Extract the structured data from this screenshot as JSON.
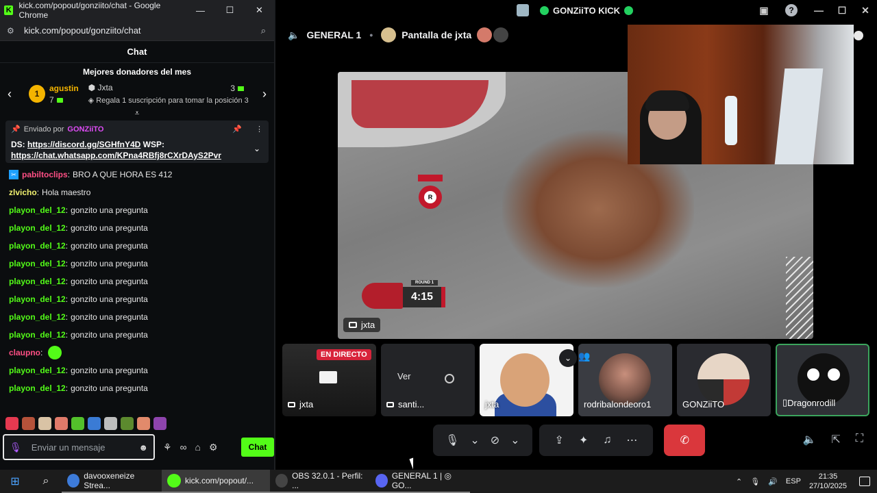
{
  "chrome": {
    "window_title": "kick.com/popout/gonziito/chat - Google Chrome",
    "url": "kick.com/popout/gonziito/chat",
    "win_minimize": "—",
    "win_maximize": "☐",
    "win_close": "✕"
  },
  "chat": {
    "header": "Chat",
    "donors_title": "Mejores donadores del mes",
    "top_donor": {
      "rank": "1",
      "name": "agustin",
      "count": "7"
    },
    "slot": {
      "name": "Jxta",
      "count": "3",
      "gift_text": "Regala 1 suscripción para tomar la posición 3"
    },
    "pinned": {
      "sent_by": "Enviado por",
      "author": "GONZiiTO",
      "line1_prefix": "DS: ",
      "line1_link": "https://discord.gg/SGHfnY4D",
      "line1_suffix": " WSP:",
      "line2_link": "https://chat.whatsapp.com/KPna4RBfj8rCXrDAyS2Pvr"
    },
    "messages": [
      {
        "user": "pabiltoclips",
        "text": "BRO A QUE HORA ES 412",
        "color": "pink",
        "badge": true
      },
      {
        "user": "zlvicho",
        "text": "Hola maestro",
        "color": "yellow",
        "badge": false
      },
      {
        "user": "playon_del_12",
        "text": "gonzito una pregunta",
        "color": "green",
        "badge": false
      },
      {
        "user": "playon_del_12",
        "text": "gonzito una pregunta",
        "color": "green",
        "badge": false
      },
      {
        "user": "playon_del_12",
        "text": "gonzito una pregunta",
        "color": "green",
        "badge": false
      },
      {
        "user": "playon_del_12",
        "text": "gonzito una pregunta",
        "color": "green",
        "badge": false
      },
      {
        "user": "playon_del_12",
        "text": "gonzito una pregunta",
        "color": "green",
        "badge": false
      },
      {
        "user": "playon_del_12",
        "text": "gonzito una pregunta",
        "color": "green",
        "badge": false
      },
      {
        "user": "playon_del_12",
        "text": "gonzito una pregunta",
        "color": "green",
        "badge": false
      },
      {
        "user": "playon_del_12",
        "text": "gonzito una pregunta",
        "color": "green",
        "badge": false
      },
      {
        "user": "claupno",
        "text": "",
        "color": "pink",
        "badge": false,
        "emote": true
      },
      {
        "user": "playon_del_12",
        "text": "gonzito una pregunta",
        "color": "green",
        "badge": false
      },
      {
        "user": "playon_del_12",
        "text": "gonzito una pregunta",
        "color": "green",
        "badge": false
      }
    ],
    "input_placeholder": "Enviar un mensaje",
    "send_label": "Chat"
  },
  "discord": {
    "title": "GONZiiTO KICK",
    "channel": "GENERAL 1",
    "screen_share": "Pantalla de jxta",
    "main_stream_label": "jxta",
    "round_label": "ROUND 1",
    "round_time": "4:15",
    "tiles": [
      {
        "label": "jxta",
        "badge": "EN DIRECTO"
      },
      {
        "label": "santi...",
        "action": "Ver"
      },
      {
        "label": "jxta"
      },
      {
        "label": "rodribalondeoro1"
      },
      {
        "label": "GONZiiTO"
      },
      {
        "label": "Dragonrodill"
      }
    ]
  },
  "taskbar": {
    "apps": [
      {
        "label": "davooxeneize Strea...",
        "color": "#3d7bd9"
      },
      {
        "label": "kick.com/popout/...",
        "color": "#53fc18"
      },
      {
        "label": "OBS 32.0.1 - Perfil: ...",
        "color": "#444444"
      },
      {
        "label": "GENERAL 1 | ◎ GO...",
        "color": "#5865f2"
      }
    ],
    "lang": "ESP",
    "time": "21:35",
    "date": "27/10/2025"
  }
}
